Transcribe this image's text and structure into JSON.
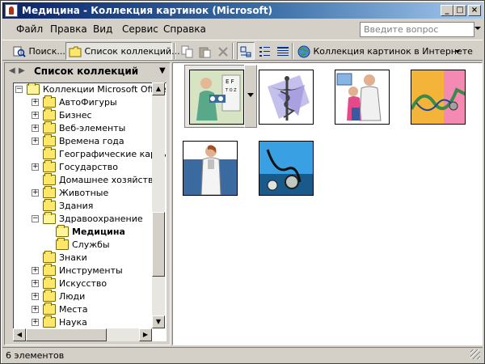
{
  "window": {
    "title": "Медицина - Коллекция картинок (Microsoft)"
  },
  "menubar": {
    "items": [
      "Файл",
      "Правка",
      "Вид",
      "Сервис",
      "Справка"
    ]
  },
  "help": {
    "placeholder": "Введите вопрос"
  },
  "toolbar": {
    "search_label": "Поиск...",
    "collections_label": "Список коллекций...",
    "online_label": "Коллекция картинок в Интернете"
  },
  "left_pane": {
    "title": "Список коллекций"
  },
  "tree": {
    "root": "Коллекции Microsoft Office",
    "items": [
      {
        "label": "АвтоФигуры",
        "expander": "+"
      },
      {
        "label": "Бизнес",
        "expander": "+"
      },
      {
        "label": "Веб-элементы",
        "expander": "+"
      },
      {
        "label": "Времена года",
        "expander": "+"
      },
      {
        "label": "Географические карты",
        "expander": ""
      },
      {
        "label": "Государство",
        "expander": "+"
      },
      {
        "label": "Домашнее хозяйство",
        "expander": ""
      },
      {
        "label": "Животные",
        "expander": "+"
      },
      {
        "label": "Здания",
        "expander": ""
      },
      {
        "label": "Здравоохранение",
        "expander": "−"
      },
      {
        "label": "Медицина",
        "expander": "",
        "child": true,
        "selected": true
      },
      {
        "label": "Службы",
        "expander": "",
        "child": true
      },
      {
        "label": "Знаки",
        "expander": ""
      },
      {
        "label": "Инструменты",
        "expander": "+"
      },
      {
        "label": "Искусство",
        "expander": "+"
      },
      {
        "label": "Люди",
        "expander": "+"
      },
      {
        "label": "Места",
        "expander": "+"
      },
      {
        "label": "Наука",
        "expander": "+"
      }
    ]
  },
  "clips": [
    {
      "name": "doctor-eye-chart"
    },
    {
      "name": "caduceus"
    },
    {
      "name": "doctor-with-child"
    },
    {
      "name": "stethoscope-colorful"
    },
    {
      "name": "doctor-woman"
    },
    {
      "name": "stethoscope-blue"
    }
  ],
  "status": {
    "text": "6 элементов"
  },
  "colors": {
    "titlebar_start": "#0a246a",
    "titlebar_end": "#a6caf0",
    "folder": "#ffe76b",
    "chrome": "#d4d0c8"
  }
}
